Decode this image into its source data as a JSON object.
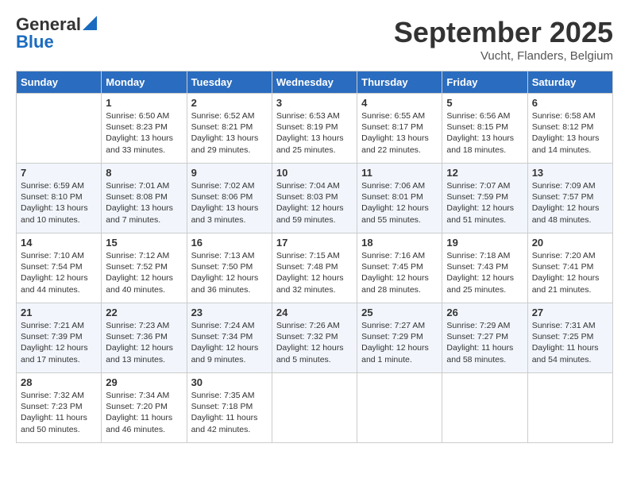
{
  "header": {
    "logo_general": "General",
    "logo_blue": "Blue",
    "month": "September 2025",
    "location": "Vucht, Flanders, Belgium"
  },
  "weekdays": [
    "Sunday",
    "Monday",
    "Tuesday",
    "Wednesday",
    "Thursday",
    "Friday",
    "Saturday"
  ],
  "weeks": [
    [
      null,
      {
        "day": 1,
        "sunrise": "Sunrise: 6:50 AM",
        "sunset": "Sunset: 8:23 PM",
        "daylight": "Daylight: 13 hours and 33 minutes."
      },
      {
        "day": 2,
        "sunrise": "Sunrise: 6:52 AM",
        "sunset": "Sunset: 8:21 PM",
        "daylight": "Daylight: 13 hours and 29 minutes."
      },
      {
        "day": 3,
        "sunrise": "Sunrise: 6:53 AM",
        "sunset": "Sunset: 8:19 PM",
        "daylight": "Daylight: 13 hours and 25 minutes."
      },
      {
        "day": 4,
        "sunrise": "Sunrise: 6:55 AM",
        "sunset": "Sunset: 8:17 PM",
        "daylight": "Daylight: 13 hours and 22 minutes."
      },
      {
        "day": 5,
        "sunrise": "Sunrise: 6:56 AM",
        "sunset": "Sunset: 8:15 PM",
        "daylight": "Daylight: 13 hours and 18 minutes."
      },
      {
        "day": 6,
        "sunrise": "Sunrise: 6:58 AM",
        "sunset": "Sunset: 8:12 PM",
        "daylight": "Daylight: 13 hours and 14 minutes."
      }
    ],
    [
      {
        "day": 7,
        "sunrise": "Sunrise: 6:59 AM",
        "sunset": "Sunset: 8:10 PM",
        "daylight": "Daylight: 13 hours and 10 minutes."
      },
      {
        "day": 8,
        "sunrise": "Sunrise: 7:01 AM",
        "sunset": "Sunset: 8:08 PM",
        "daylight": "Daylight: 13 hours and 7 minutes."
      },
      {
        "day": 9,
        "sunrise": "Sunrise: 7:02 AM",
        "sunset": "Sunset: 8:06 PM",
        "daylight": "Daylight: 13 hours and 3 minutes."
      },
      {
        "day": 10,
        "sunrise": "Sunrise: 7:04 AM",
        "sunset": "Sunset: 8:03 PM",
        "daylight": "Daylight: 12 hours and 59 minutes."
      },
      {
        "day": 11,
        "sunrise": "Sunrise: 7:06 AM",
        "sunset": "Sunset: 8:01 PM",
        "daylight": "Daylight: 12 hours and 55 minutes."
      },
      {
        "day": 12,
        "sunrise": "Sunrise: 7:07 AM",
        "sunset": "Sunset: 7:59 PM",
        "daylight": "Daylight: 12 hours and 51 minutes."
      },
      {
        "day": 13,
        "sunrise": "Sunrise: 7:09 AM",
        "sunset": "Sunset: 7:57 PM",
        "daylight": "Daylight: 12 hours and 48 minutes."
      }
    ],
    [
      {
        "day": 14,
        "sunrise": "Sunrise: 7:10 AM",
        "sunset": "Sunset: 7:54 PM",
        "daylight": "Daylight: 12 hours and 44 minutes."
      },
      {
        "day": 15,
        "sunrise": "Sunrise: 7:12 AM",
        "sunset": "Sunset: 7:52 PM",
        "daylight": "Daylight: 12 hours and 40 minutes."
      },
      {
        "day": 16,
        "sunrise": "Sunrise: 7:13 AM",
        "sunset": "Sunset: 7:50 PM",
        "daylight": "Daylight: 12 hours and 36 minutes."
      },
      {
        "day": 17,
        "sunrise": "Sunrise: 7:15 AM",
        "sunset": "Sunset: 7:48 PM",
        "daylight": "Daylight: 12 hours and 32 minutes."
      },
      {
        "day": 18,
        "sunrise": "Sunrise: 7:16 AM",
        "sunset": "Sunset: 7:45 PM",
        "daylight": "Daylight: 12 hours and 28 minutes."
      },
      {
        "day": 19,
        "sunrise": "Sunrise: 7:18 AM",
        "sunset": "Sunset: 7:43 PM",
        "daylight": "Daylight: 12 hours and 25 minutes."
      },
      {
        "day": 20,
        "sunrise": "Sunrise: 7:20 AM",
        "sunset": "Sunset: 7:41 PM",
        "daylight": "Daylight: 12 hours and 21 minutes."
      }
    ],
    [
      {
        "day": 21,
        "sunrise": "Sunrise: 7:21 AM",
        "sunset": "Sunset: 7:39 PM",
        "daylight": "Daylight: 12 hours and 17 minutes."
      },
      {
        "day": 22,
        "sunrise": "Sunrise: 7:23 AM",
        "sunset": "Sunset: 7:36 PM",
        "daylight": "Daylight: 12 hours and 13 minutes."
      },
      {
        "day": 23,
        "sunrise": "Sunrise: 7:24 AM",
        "sunset": "Sunset: 7:34 PM",
        "daylight": "Daylight: 12 hours and 9 minutes."
      },
      {
        "day": 24,
        "sunrise": "Sunrise: 7:26 AM",
        "sunset": "Sunset: 7:32 PM",
        "daylight": "Daylight: 12 hours and 5 minutes."
      },
      {
        "day": 25,
        "sunrise": "Sunrise: 7:27 AM",
        "sunset": "Sunset: 7:29 PM",
        "daylight": "Daylight: 12 hours and 1 minute."
      },
      {
        "day": 26,
        "sunrise": "Sunrise: 7:29 AM",
        "sunset": "Sunset: 7:27 PM",
        "daylight": "Daylight: 11 hours and 58 minutes."
      },
      {
        "day": 27,
        "sunrise": "Sunrise: 7:31 AM",
        "sunset": "Sunset: 7:25 PM",
        "daylight": "Daylight: 11 hours and 54 minutes."
      }
    ],
    [
      {
        "day": 28,
        "sunrise": "Sunrise: 7:32 AM",
        "sunset": "Sunset: 7:23 PM",
        "daylight": "Daylight: 11 hours and 50 minutes."
      },
      {
        "day": 29,
        "sunrise": "Sunrise: 7:34 AM",
        "sunset": "Sunset: 7:20 PM",
        "daylight": "Daylight: 11 hours and 46 minutes."
      },
      {
        "day": 30,
        "sunrise": "Sunrise: 7:35 AM",
        "sunset": "Sunset: 7:18 PM",
        "daylight": "Daylight: 11 hours and 42 minutes."
      },
      null,
      null,
      null,
      null
    ]
  ]
}
